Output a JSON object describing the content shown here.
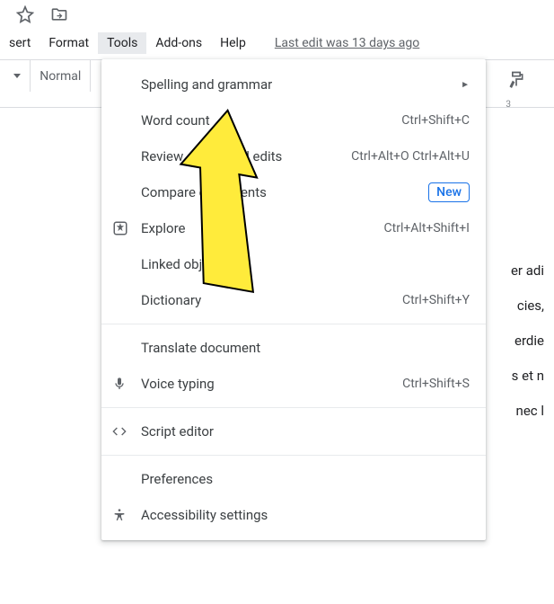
{
  "menubar": {
    "insert": "sert",
    "format": "Format",
    "tools": "Tools",
    "addons": "Add-ons",
    "help": "Help"
  },
  "last_edit": "Last edit was 13 days ago",
  "toolbar": {
    "styles_label": "Normal"
  },
  "ruler_3": "3",
  "tools_menu": {
    "spelling": {
      "label": "Spelling and grammar"
    },
    "word_count": {
      "label": "Word count",
      "shortcut": "Ctrl+Shift+C"
    },
    "review_edits": {
      "label": "Review suggested edits",
      "shortcut": "Ctrl+Alt+O Ctrl+Alt+U"
    },
    "compare": {
      "label": "Compare documents",
      "badge": "New"
    },
    "explore": {
      "label": "Explore",
      "shortcut": "Ctrl+Alt+Shift+I"
    },
    "linked_objects": {
      "label": "Linked objects"
    },
    "dictionary": {
      "label": "Dictionary",
      "shortcut": "Ctrl+Shift+Y"
    },
    "translate": {
      "label": "Translate document"
    },
    "voice": {
      "label": "Voice typing",
      "shortcut": "Ctrl+Shift+S"
    },
    "script_editor": {
      "label": "Script editor"
    },
    "preferences": {
      "label": "Preferences"
    },
    "accessibility": {
      "label": "Accessibility settings"
    }
  },
  "document_fragments": {
    "l1": "er adi",
    "l2": "cies,",
    "l3": "erdie",
    "l4": "s et n",
    "l5": "nec l"
  }
}
